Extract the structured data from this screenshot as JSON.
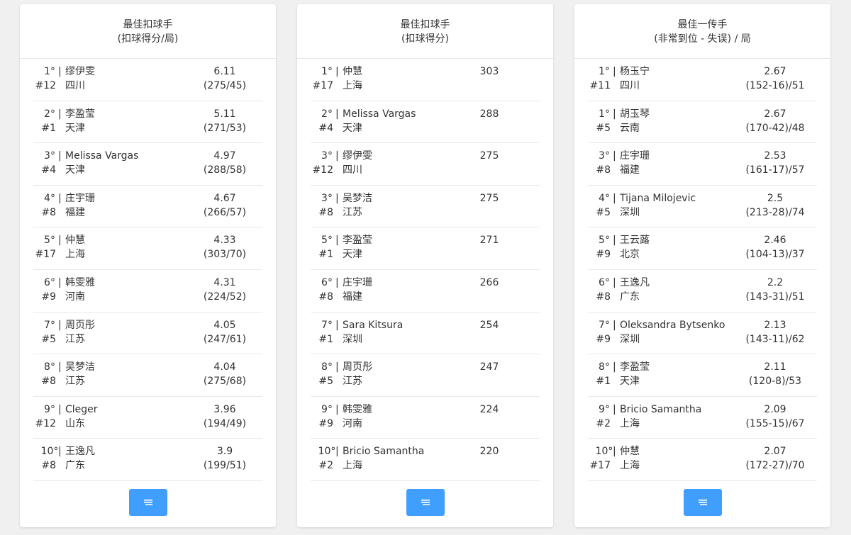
{
  "panels": [
    {
      "title1": "最佳扣球手",
      "title2": "(扣球得分/局)",
      "button_icon": "list-icon",
      "rows": [
        {
          "rank": "1°",
          "num": "#12",
          "name": "缪伊雯",
          "team": "四川",
          "value": "6.11",
          "sub": "(275/45)"
        },
        {
          "rank": "2°",
          "num": "#1",
          "name": "李盈莹",
          "team": "天津",
          "value": "5.11",
          "sub": "(271/53)"
        },
        {
          "rank": "3°",
          "num": "#4",
          "name": "Melissa Vargas",
          "team": "天津",
          "value": "4.97",
          "sub": "(288/58)"
        },
        {
          "rank": "4°",
          "num": "#8",
          "name": "庄宇珊",
          "team": "福建",
          "value": "4.67",
          "sub": "(266/57)"
        },
        {
          "rank": "5°",
          "num": "#17",
          "name": "仲慧",
          "team": "上海",
          "value": "4.33",
          "sub": "(303/70)"
        },
        {
          "rank": "6°",
          "num": "#9",
          "name": "韩雯雅",
          "team": "河南",
          "value": "4.31",
          "sub": "(224/52)"
        },
        {
          "rank": "7°",
          "num": "#5",
          "name": "周页彤",
          "team": "江苏",
          "value": "4.05",
          "sub": "(247/61)"
        },
        {
          "rank": "8°",
          "num": "#8",
          "name": "吴梦洁",
          "team": "江苏",
          "value": "4.04",
          "sub": "(275/68)"
        },
        {
          "rank": "9°",
          "num": "#12",
          "name": "Cleger",
          "team": "山东",
          "value": "3.96",
          "sub": "(194/49)"
        },
        {
          "rank": "10°",
          "num": "#8",
          "name": "王逸凡",
          "team": "广东",
          "value": "3.9",
          "sub": "(199/51)"
        }
      ]
    },
    {
      "title1": "最佳扣球手",
      "title2": "(扣球得分)",
      "button_icon": "list-icon",
      "rows": [
        {
          "rank": "1°",
          "num": "#17",
          "name": "仲慧",
          "team": "上海",
          "value": "303"
        },
        {
          "rank": "2°",
          "num": "#4",
          "name": "Melissa Vargas",
          "team": "天津",
          "value": "288"
        },
        {
          "rank": "3°",
          "num": "#12",
          "name": "缪伊雯",
          "team": "四川",
          "value": "275"
        },
        {
          "rank": "3°",
          "num": "#8",
          "name": "吴梦洁",
          "team": "江苏",
          "value": "275"
        },
        {
          "rank": "5°",
          "num": "#1",
          "name": "李盈莹",
          "team": "天津",
          "value": "271"
        },
        {
          "rank": "6°",
          "num": "#8",
          "name": "庄宇珊",
          "team": "福建",
          "value": "266"
        },
        {
          "rank": "7°",
          "num": "#1",
          "name": "Sara Kitsura",
          "team": "深圳",
          "value": "254"
        },
        {
          "rank": "8°",
          "num": "#5",
          "name": "周页彤",
          "team": "江苏",
          "value": "247"
        },
        {
          "rank": "9°",
          "num": "#9",
          "name": "韩雯雅",
          "team": "河南",
          "value": "224"
        },
        {
          "rank": "10°",
          "num": "#2",
          "name": "Bricio Samantha",
          "team": "上海",
          "value": "220"
        }
      ]
    },
    {
      "title1": "最佳一传手",
      "title2": "(非常到位 - 失误) / 局",
      "button_icon": "list-icon",
      "rows": [
        {
          "rank": "1°",
          "num": "#11",
          "name": "杨玉宁",
          "team": "四川",
          "value": "2.67",
          "sub": "(152-16)/51"
        },
        {
          "rank": "1°",
          "num": "#5",
          "name": "胡玉琴",
          "team": "云南",
          "value": "2.67",
          "sub": "(170-42)/48"
        },
        {
          "rank": "3°",
          "num": "#8",
          "name": "庄宇珊",
          "team": "福建",
          "value": "2.53",
          "sub": "(161-17)/57"
        },
        {
          "rank": "4°",
          "num": "#5",
          "name": "Tijana Milojevic",
          "team": "深圳",
          "value": "2.5",
          "sub": "(213-28)/74"
        },
        {
          "rank": "5°",
          "num": "#9",
          "name": "王云蕗",
          "team": "北京",
          "value": "2.46",
          "sub": "(104-13)/37"
        },
        {
          "rank": "6°",
          "num": "#8",
          "name": "王逸凡",
          "team": "广东",
          "value": "2.2",
          "sub": "(143-31)/51"
        },
        {
          "rank": "7°",
          "num": "#9",
          "name": "Oleksandra Bytsenko",
          "team": "深圳",
          "value": "2.13",
          "sub": "(143-11)/62"
        },
        {
          "rank": "8°",
          "num": "#1",
          "name": "李盈莹",
          "team": "天津",
          "value": "2.11",
          "sub": "(120-8)/53"
        },
        {
          "rank": "9°",
          "num": "#2",
          "name": "Bricio Samantha",
          "team": "上海",
          "value": "2.09",
          "sub": "(155-15)/67"
        },
        {
          "rank": "10°",
          "num": "#17",
          "name": "仲慧",
          "team": "上海",
          "value": "2.07",
          "sub": "(172-27)/70"
        }
      ]
    }
  ]
}
